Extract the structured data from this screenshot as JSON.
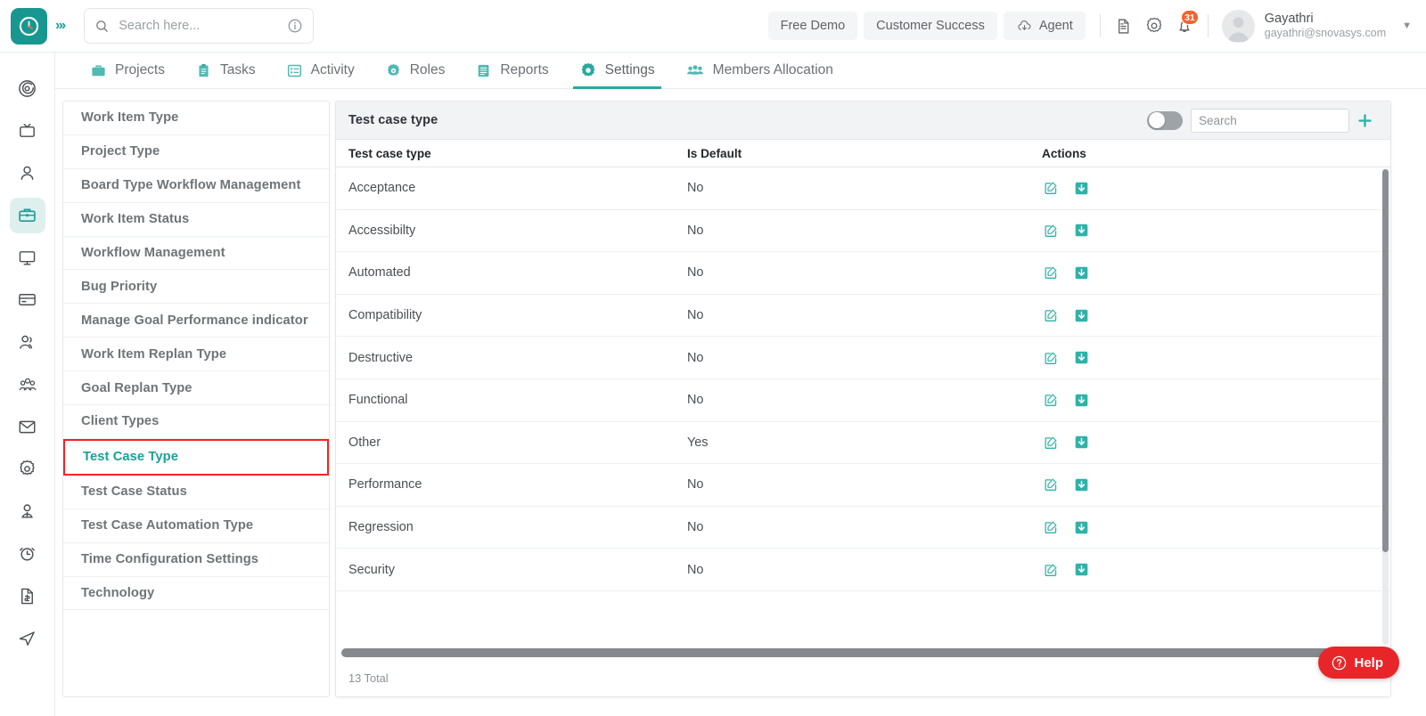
{
  "header": {
    "logo_icon": "clock-logo-icon",
    "expand_icon": "chevrons-right-icon",
    "search": {
      "placeholder": "Search here...",
      "value": "",
      "icon": "search-icon",
      "info_icon": "info-circle-icon"
    },
    "pills": [
      {
        "label": "Free Demo",
        "icon": null
      },
      {
        "label": "Customer Success",
        "icon": null
      },
      {
        "label": "Agent",
        "icon": "cloud-download-icon"
      }
    ],
    "icons": [
      {
        "name": "document-icon"
      },
      {
        "name": "gear-icon"
      },
      {
        "name": "bell-icon",
        "badge": "31"
      }
    ],
    "user": {
      "name": "Gayathri",
      "email": "gayathri@snovasys.com",
      "avatar": "user-avatar",
      "caret": "chevron-down-icon"
    }
  },
  "nav": {
    "tabs": [
      {
        "label": "Projects",
        "icon": "briefcase-icon",
        "active": false
      },
      {
        "label": "Tasks",
        "icon": "clipboard-icon",
        "active": false
      },
      {
        "label": "Activity",
        "icon": "list-box-icon",
        "active": false
      },
      {
        "label": "Roles",
        "icon": "target-gear-icon",
        "active": false
      },
      {
        "label": "Reports",
        "icon": "report-icon",
        "active": false
      },
      {
        "label": "Settings",
        "icon": "gear-icon",
        "active": true
      },
      {
        "label": "Members Allocation",
        "icon": "people-group-icon",
        "active": false
      }
    ]
  },
  "rail": {
    "items": [
      {
        "name": "target-icon",
        "active": false
      },
      {
        "name": "tv-icon",
        "active": false
      },
      {
        "name": "user-icon",
        "active": false
      },
      {
        "name": "briefcase-icon",
        "active": true
      },
      {
        "name": "monitor-icon",
        "active": false
      },
      {
        "name": "card-icon",
        "active": false
      },
      {
        "name": "users-icon",
        "active": false
      },
      {
        "name": "people-group-icon",
        "active": false
      },
      {
        "name": "mail-icon",
        "active": false
      },
      {
        "name": "gear-icon",
        "active": false
      },
      {
        "name": "person-badge-icon",
        "active": false
      },
      {
        "name": "alarm-clock-icon",
        "active": false
      },
      {
        "name": "invoice-icon",
        "active": false
      },
      {
        "name": "send-icon",
        "active": false
      }
    ]
  },
  "settings_list": {
    "items": [
      {
        "label": "Work Item Type",
        "selected": false
      },
      {
        "label": "Project Type",
        "selected": false
      },
      {
        "label": "Board Type Workflow Management",
        "selected": false
      },
      {
        "label": "Work Item Status",
        "selected": false
      },
      {
        "label": "Workflow Management",
        "selected": false
      },
      {
        "label": "Bug Priority",
        "selected": false
      },
      {
        "label": "Manage Goal Performance indicator",
        "selected": false
      },
      {
        "label": "Work Item Replan Type",
        "selected": false
      },
      {
        "label": "Goal Replan Type",
        "selected": false
      },
      {
        "label": "Client Types",
        "selected": false
      },
      {
        "label": "Test Case Type",
        "selected": true
      },
      {
        "label": "Test Case Status",
        "selected": false
      },
      {
        "label": "Test Case Automation Type",
        "selected": false
      },
      {
        "label": "Time Configuration Settings",
        "selected": false
      },
      {
        "label": "Technology",
        "selected": false
      }
    ],
    "selected_outline_color": "#fc2020",
    "selected_text_color": "#1aa09a"
  },
  "panel": {
    "title": "Test case type",
    "toggle": {
      "name": "filter-toggle",
      "on": false
    },
    "search": {
      "placeholder": "Search",
      "value": ""
    },
    "add_button": {
      "label": "+",
      "icon": "plus-icon"
    },
    "columns": [
      "Test case type",
      "Is Default",
      "Actions"
    ],
    "rows": [
      {
        "type": "Acceptance",
        "is_default": "No"
      },
      {
        "type": "Accessibilty",
        "is_default": "No"
      },
      {
        "type": "Automated",
        "is_default": "No"
      },
      {
        "type": "Compatibility",
        "is_default": "No"
      },
      {
        "type": "Destructive",
        "is_default": "No"
      },
      {
        "type": "Functional",
        "is_default": "No"
      },
      {
        "type": "Other",
        "is_default": "Yes"
      },
      {
        "type": "Performance",
        "is_default": "No"
      },
      {
        "type": "Regression",
        "is_default": "No"
      },
      {
        "type": "Security",
        "is_default": "No"
      }
    ],
    "row_actions": [
      {
        "name": "edit-icon"
      },
      {
        "name": "download-icon"
      }
    ],
    "footer_total": "13 Total",
    "accent_color": "#2fb2a8"
  },
  "help": {
    "label": "Help",
    "icon": "question-circle-icon",
    "color": "#e8262a"
  }
}
